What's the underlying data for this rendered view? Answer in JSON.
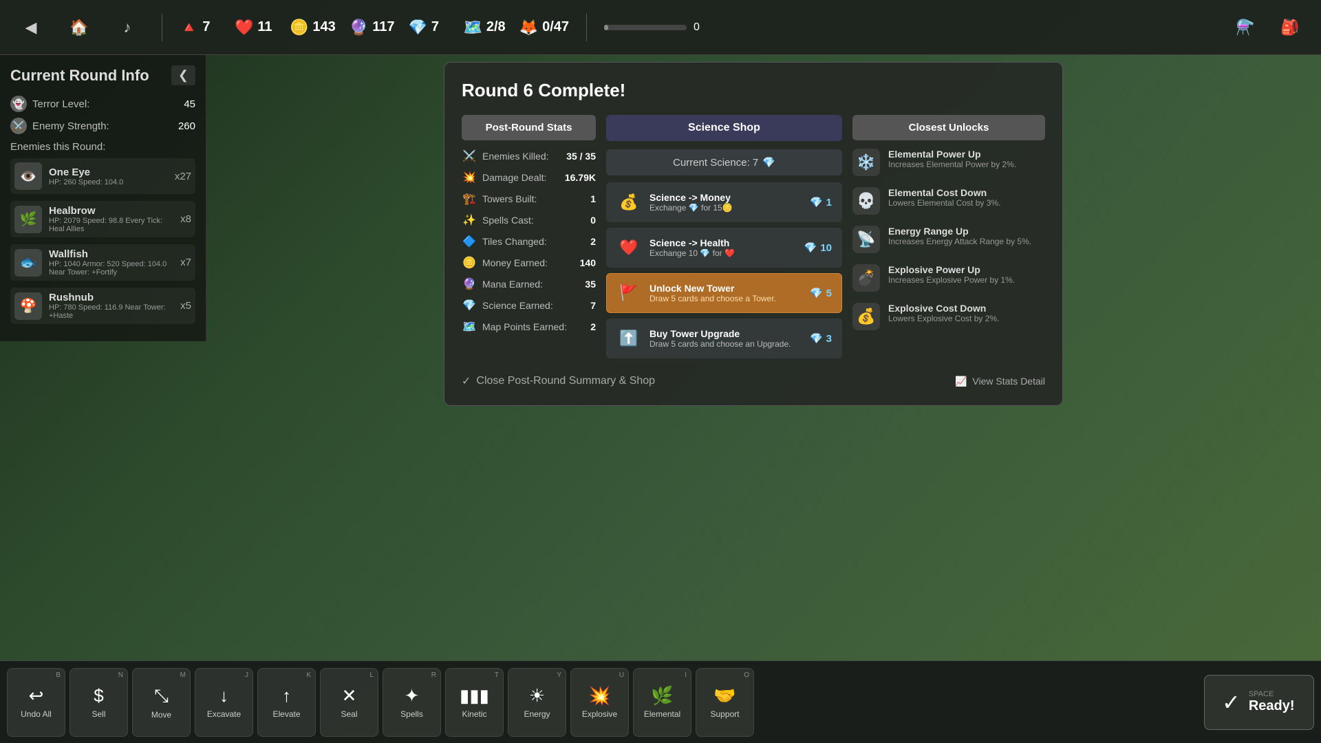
{
  "topbar": {
    "back_icon": "◀",
    "tower_icon": "🏠",
    "music_icon": "♪",
    "stats": [
      {
        "icon": "🔺",
        "value": "7",
        "color": "#e06040"
      },
      {
        "icon": "❤️",
        "value": "11",
        "color": "#e05060"
      },
      {
        "icon": "🪙",
        "value": "143",
        "color": "#f0c030"
      },
      {
        "icon": "🔮",
        "value": "117",
        "color": "#d060d0"
      },
      {
        "icon": "💎",
        "value": "7",
        "color": "#7dd4f8"
      },
      {
        "icon": "🗺️",
        "value": "2/8",
        "color": "#80cc80"
      },
      {
        "icon": "🦊",
        "value": "0/47",
        "color": "#aaa"
      },
      {
        "icon": "🎯",
        "value": "0",
        "color": "#aaa"
      }
    ],
    "flask_icon": "⚗️",
    "bag_icon": "🎒"
  },
  "sidebar": {
    "title": "Current Round Info",
    "collapse_icon": "❮",
    "terror_label": "Terror Level:",
    "terror_value": "45",
    "enemy_strength_label": "Enemy Strength:",
    "enemy_strength_value": "260",
    "enemies_this_round_label": "Enemies this Round:",
    "enemies": [
      {
        "icon": "👁️",
        "name": "One Eye",
        "stats": "HP: 260 Speed: 104.0",
        "count": "x27"
      },
      {
        "icon": "🌿",
        "name": "Healbrow",
        "stats": "HP: 2079 Speed: 98.8\nEvery Tick: Heal Allies",
        "count": "x8"
      },
      {
        "icon": "🐟",
        "name": "Wallfish",
        "stats": "HP: 1040 Armor: 520 Speed: 104.0\nNear Tower: +Fortify",
        "count": "x7"
      },
      {
        "icon": "🍄",
        "name": "Rushnub",
        "stats": "HP: 780 Speed: 116.9\nNear Tower: +Haste",
        "count": "x5"
      }
    ]
  },
  "modal": {
    "title": "Round 6 Complete!",
    "post_round": {
      "header": "Post-Round Stats",
      "stats": [
        {
          "icon": "⚔️",
          "label": "Enemies Killed:",
          "value": "35 / 35"
        },
        {
          "icon": "💥",
          "label": "Damage Dealt:",
          "value": "16.79K"
        },
        {
          "icon": "🏗️",
          "label": "Towers Built:",
          "value": "1"
        },
        {
          "icon": "✨",
          "label": "Spells Cast:",
          "value": "0"
        },
        {
          "icon": "🔷",
          "label": "Tiles Changed:",
          "value": "2"
        },
        {
          "icon": "🪙",
          "label": "Money Earned:",
          "value": "140"
        },
        {
          "icon": "🔮",
          "label": "Mana Earned:",
          "value": "35"
        },
        {
          "icon": "💎",
          "label": "Science Earned:",
          "value": "7"
        },
        {
          "icon": "🗺️",
          "label": "Map Points Earned:",
          "value": "2"
        }
      ]
    },
    "science_shop": {
      "header": "Science Shop",
      "current_science_label": "Current Science: 7",
      "items": [
        {
          "icon": "💰",
          "title": "Science -> Money",
          "desc": "Exchange 💎 for 15🪙",
          "cost": "1",
          "selected": false
        },
        {
          "icon": "❤️",
          "title": "Science -> Health",
          "desc": "Exchange 10 💎 for ❤️",
          "cost": "10",
          "selected": false
        },
        {
          "icon": "🚩",
          "title": "Unlock New Tower",
          "desc": "Draw 5 cards and choose a Tower.",
          "cost": "5",
          "selected": true
        },
        {
          "icon": "⬆️",
          "title": "Buy Tower Upgrade",
          "desc": "Draw 5 cards and choose an Upgrade.",
          "cost": "3",
          "selected": false
        }
      ]
    },
    "closest_unlocks": {
      "header": "Closest Unlocks",
      "items": [
        {
          "icon": "❄️",
          "title": "Elemental Power Up",
          "desc": "Increases Elemental Power by 2%."
        },
        {
          "icon": "💀",
          "title": "Elemental Cost Down",
          "desc": "Lowers Elemental Cost by 3%."
        },
        {
          "icon": "📡",
          "title": "Energy Range Up",
          "desc": "Increases Energy Attack Range by 5%."
        },
        {
          "icon": "💣",
          "title": "Explosive Power Up",
          "desc": "Increases Explosive Power by 1%."
        },
        {
          "icon": "💰",
          "title": "Explosive Cost Down",
          "desc": "Lowers Explosive Cost by 2%."
        }
      ]
    },
    "close_btn_label": "Close Post-Round Summary & Shop",
    "view_stats_label": "View Stats Detail"
  },
  "bottombar": {
    "actions": [
      {
        "key": "B",
        "icon": "↩",
        "label": "Undo All"
      },
      {
        "key": "N",
        "icon": "$",
        "label": "Sell"
      },
      {
        "key": "M",
        "icon": "⤡",
        "label": "Move"
      },
      {
        "key": "J",
        "icon": "↓",
        "label": "Excavate"
      },
      {
        "key": "K",
        "icon": "↑",
        "label": "Elevate"
      },
      {
        "key": "L",
        "icon": "✕",
        "label": "Seal"
      },
      {
        "key": "R",
        "icon": "✦",
        "label": "Spells"
      },
      {
        "key": "T",
        "icon": "▮▮▮",
        "label": "Kinetic"
      },
      {
        "key": "Y",
        "icon": "☀",
        "label": "Energy"
      },
      {
        "key": "U",
        "icon": "💥",
        "label": "Explosive"
      },
      {
        "key": "I",
        "icon": "🌿",
        "label": "Elemental"
      },
      {
        "key": "O",
        "icon": "🤝",
        "label": "Support"
      }
    ],
    "ready": {
      "key": "SPACE",
      "label": "Ready!"
    }
  }
}
